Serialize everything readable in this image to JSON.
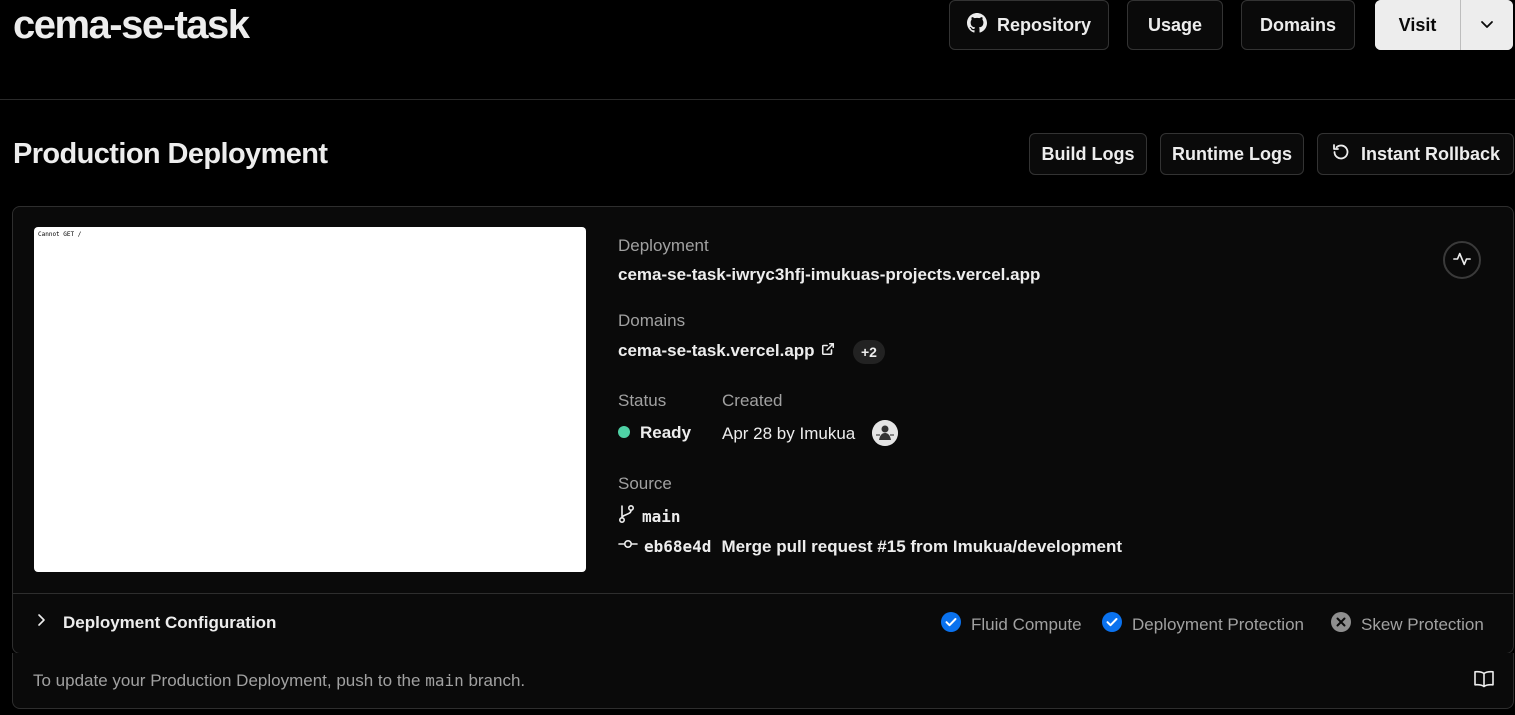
{
  "header": {
    "project_name": "cema-se-task",
    "buttons": {
      "repository": "Repository",
      "usage": "Usage",
      "domains": "Domains",
      "visit": "Visit"
    }
  },
  "section": {
    "title": "Production Deployment",
    "buttons": {
      "build_logs": "Build Logs",
      "runtime_logs": "Runtime Logs",
      "instant_rollback": "Instant Rollback"
    }
  },
  "deployment": {
    "preview_text": "Cannot GET /",
    "deployment_label": "Deployment",
    "deployment_url": "cema-se-task-iwryc3hfj-imukuas-projects.vercel.app",
    "domains_label": "Domains",
    "domain": "cema-se-task.vercel.app",
    "more_domains": "+2",
    "status_label": "Status",
    "status_value": "Ready",
    "status_color": "#4fd1a5",
    "created_label": "Created",
    "created_value": "Apr 28 by Imukua",
    "source_label": "Source",
    "branch": "main",
    "commit_sha": "eb68e4d",
    "commit_message": "Merge pull request #15 from Imukua/development"
  },
  "config": {
    "label": "Deployment Configuration",
    "features": [
      {
        "label": "Fluid Compute",
        "enabled": true,
        "icon": "check-circle-icon"
      },
      {
        "label": "Deployment Protection",
        "enabled": true,
        "icon": "check-circle-icon"
      },
      {
        "label": "Skew Protection",
        "enabled": false,
        "icon": "x-circle-icon"
      }
    ],
    "enabled_color": "#0a72ef"
  },
  "footer": {
    "text_before": "To update your Production Deployment, push to the ",
    "branch": "main",
    "text_after": " branch."
  }
}
